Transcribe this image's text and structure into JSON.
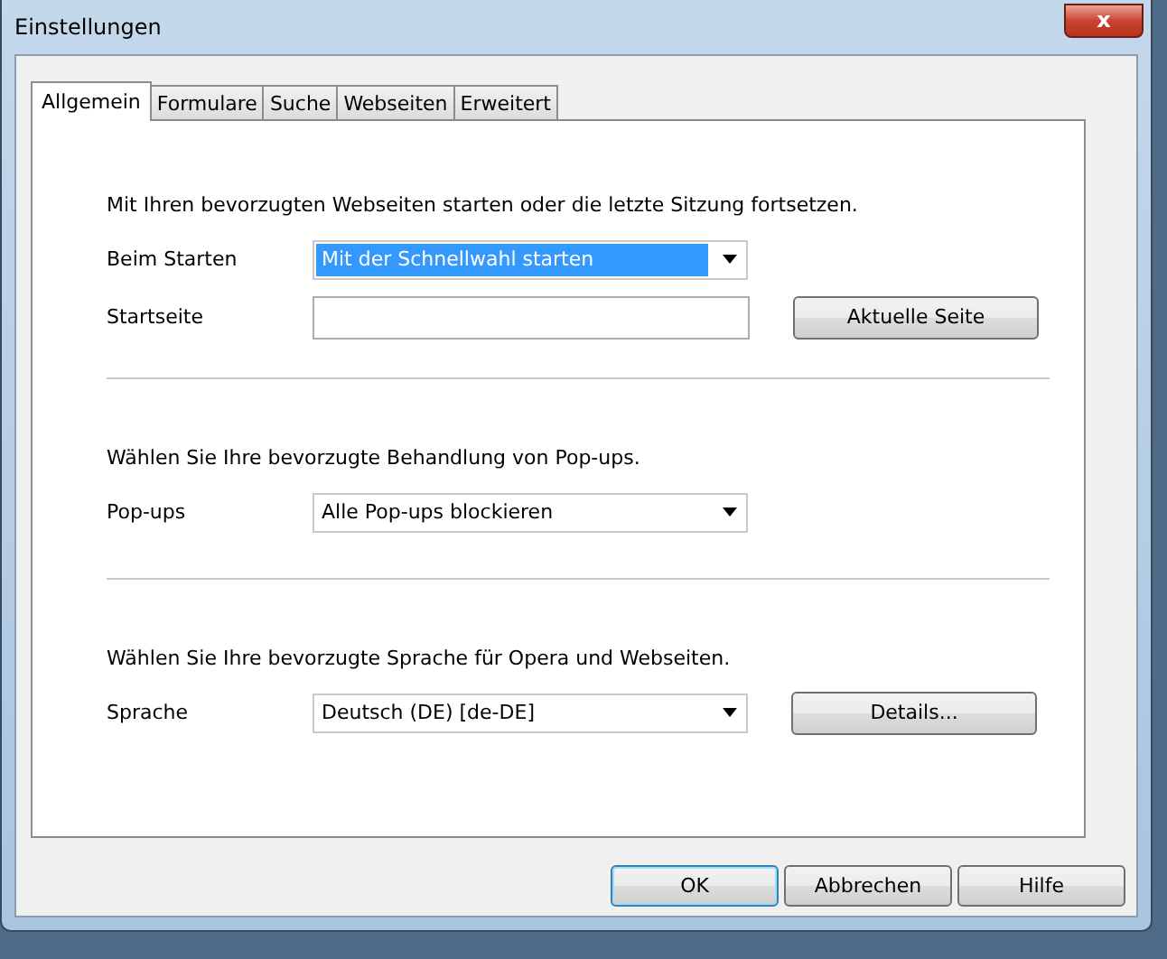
{
  "window": {
    "title": "Einstellungen",
    "close": "x"
  },
  "tabs": [
    {
      "label": "Allgemein",
      "selected": true
    },
    {
      "label": "Formulare",
      "selected": false
    },
    {
      "label": "Suche",
      "selected": false
    },
    {
      "label": "Webseiten",
      "selected": false
    },
    {
      "label": "Erweitert",
      "selected": false
    }
  ],
  "sections": [
    {
      "description": "Mit Ihren bevorzugten Webseiten starten oder die letzte Sitzung fortsetzen.",
      "rows": [
        {
          "label": "Beim Starten",
          "kind": "select",
          "value": "Mit der Schnellwahl starten",
          "focused": true
        },
        {
          "label": "Startseite",
          "kind": "text",
          "value": "",
          "button": "Aktuelle Seite"
        }
      ]
    },
    {
      "description": "Wählen Sie Ihre bevorzugte Behandlung von Pop-ups.",
      "rows": [
        {
          "label": "Pop-ups",
          "kind": "select",
          "value": "Alle Pop-ups blockieren",
          "focused": false
        }
      ]
    },
    {
      "description": "Wählen Sie Ihre bevorzugte Sprache für Opera und Webseiten.",
      "rows": [
        {
          "label": "Sprache",
          "kind": "select",
          "value": "Deutsch (DE) [de-DE]",
          "focused": false,
          "button": "Details..."
        }
      ]
    }
  ],
  "buttons": [
    {
      "label": "OK",
      "default": true
    },
    {
      "label": "Abbrechen",
      "default": false
    },
    {
      "label": "Hilfe",
      "default": false
    }
  ]
}
